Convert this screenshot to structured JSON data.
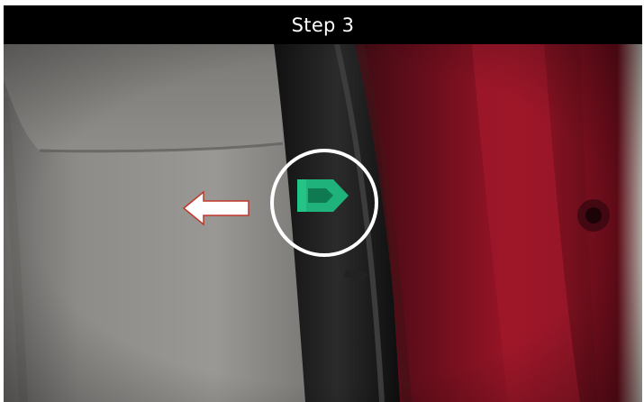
{
  "header": {
    "title": "Step 3"
  },
  "photo": {
    "subject": "clip-removal-step-photo",
    "colors": {
      "title_bar_bg": "#000000",
      "title_text": "#ffffff",
      "trim_panel": "#8f8d8a",
      "clip": "#1fb27a",
      "door_frame_red": "#7a0f1e",
      "circle_outline": "#ffffff",
      "arrow_fill": "#ffffff",
      "arrow_outline": "#c0392b"
    },
    "icons": {
      "direction_arrow": "left-arrow-icon",
      "highlight_ring": "circle-highlight-icon",
      "clip": "push-clip-icon"
    }
  }
}
